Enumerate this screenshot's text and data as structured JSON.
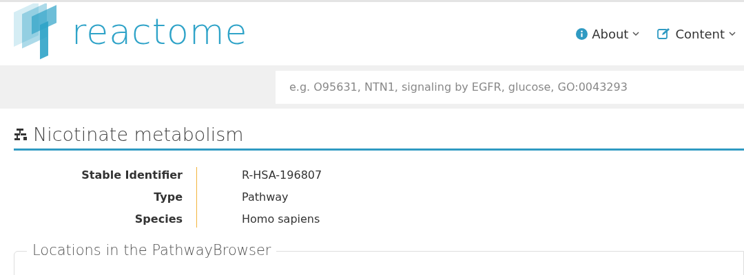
{
  "header": {
    "logo_text": "reactome",
    "nav": [
      {
        "label": "About",
        "kind": "info"
      },
      {
        "label": "Content",
        "kind": "edit"
      }
    ]
  },
  "search": {
    "placeholder": "e.g. O95631, NTN1, signaling by EGFR, glucose, GO:0043293"
  },
  "title": "Nicotinate metabolism",
  "details": [
    {
      "label": "Stable Identifier",
      "value": "R-HSA-196807"
    },
    {
      "label": "Type",
      "value": "Pathway"
    },
    {
      "label": "Species",
      "value": "Homo sapiens"
    }
  ],
  "section": {
    "legend": "Locations in the PathwayBrowser"
  }
}
